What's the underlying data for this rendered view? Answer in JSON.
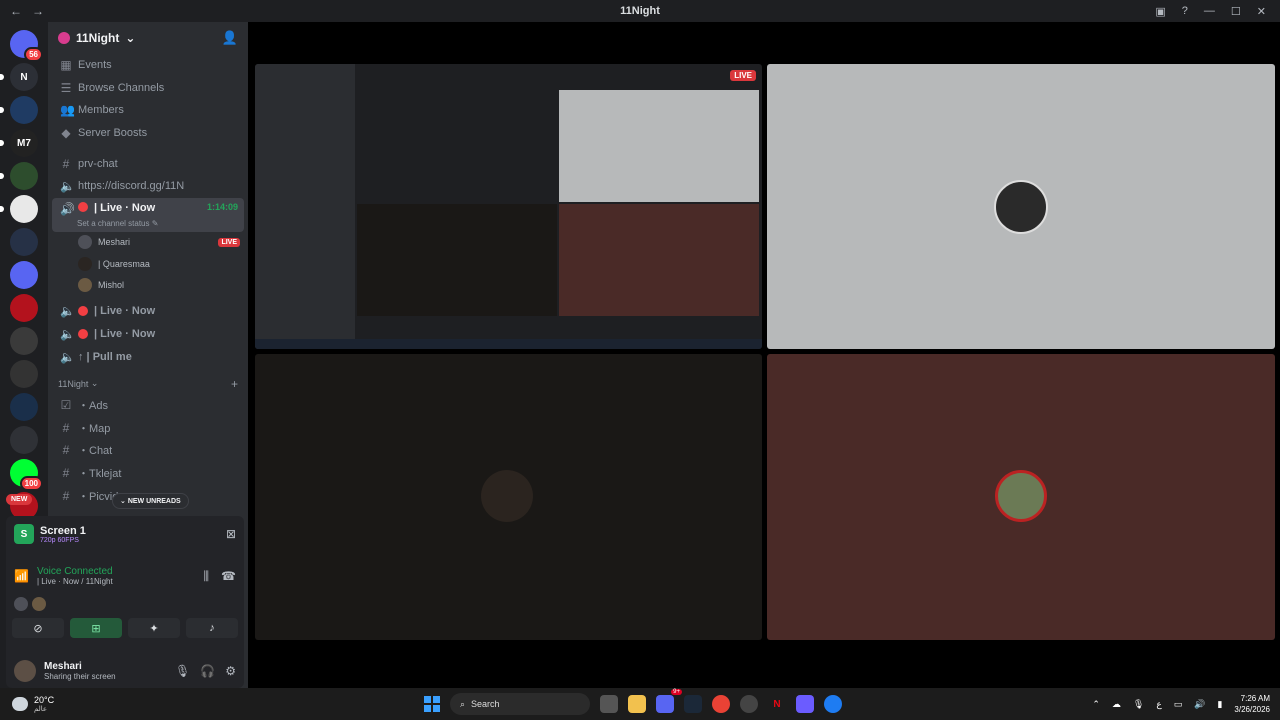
{
  "window": {
    "title": "11Night"
  },
  "servers": [
    {
      "label": "",
      "badge": "56",
      "color": "#5865f2"
    },
    {
      "label": "N",
      "badge": "",
      "color": "#2c2f36"
    },
    {
      "label": "",
      "badge": "",
      "color": "#1f3b63"
    },
    {
      "label": "M7",
      "badge": "",
      "color": "#222"
    },
    {
      "label": "",
      "badge": "",
      "color": "#2d4d2d"
    },
    {
      "label": "",
      "badge": "",
      "color": "#e8e8e8"
    },
    {
      "label": "",
      "badge": "",
      "color": "#263146"
    },
    {
      "label": "",
      "badge": "",
      "color": "#5865f2"
    },
    {
      "label": "",
      "badge": "",
      "color": "#b3121d"
    },
    {
      "label": "",
      "badge": "",
      "color": "#3a3a3a"
    },
    {
      "label": "",
      "badge": "",
      "color": "#333"
    },
    {
      "label": "",
      "badge": "",
      "color": "#1a2f4a"
    },
    {
      "label": "",
      "badge": "",
      "color": "#2f3136"
    },
    {
      "label": "",
      "badge": "100",
      "color": "#0f3"
    },
    {
      "label": "",
      "badge": "",
      "color": "#b3121d"
    }
  ],
  "sidebar": {
    "guild_name": "11Night",
    "nav": [
      "Events",
      "Browse Channels",
      "Members",
      "Server Boosts"
    ],
    "text_channels": [
      "prv-chat",
      "https://discord.gg/11N"
    ],
    "live_channel": {
      "name": "| Live · Now",
      "time": "1:14:09",
      "status": "Set a channel status"
    },
    "voice_users": [
      {
        "name": "Meshari",
        "live": "LIVE"
      },
      {
        "name": "| Quaresmaa",
        "live": ""
      },
      {
        "name": "Mishol",
        "live": ""
      }
    ],
    "voice_channels": [
      "| Live · Now",
      "| Live · Now",
      "↑ | Pull me"
    ],
    "category": "11Night",
    "category_channels": [
      "・Ads",
      "・Map",
      "・Chat",
      "・Tklejat",
      "・Picvid"
    ],
    "new_unreads": "NEW UNREADS",
    "new_label": "NEW"
  },
  "panel": {
    "screen_title": "Screen 1",
    "screen_quality": "720p 60FPS",
    "voice_status": "Voice Connected",
    "voice_channel": "| Live · Now / 11Night",
    "user_name": "Meshari",
    "user_status": "Sharing their screen"
  },
  "stage": {
    "live_label": "LIVE"
  },
  "taskbar": {
    "temperature": "20°C",
    "location": "عالم",
    "search": "Search",
    "notif_count": "9+",
    "lang": "ع",
    "time": "7:26 AM",
    "date": "3/26/2026"
  }
}
